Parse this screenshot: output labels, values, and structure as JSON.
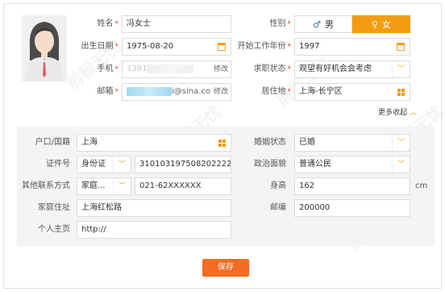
{
  "profile": {
    "name": {
      "label": "姓名",
      "value": "冯女士"
    },
    "gender": {
      "label": "性别",
      "male": "男",
      "female": "女",
      "selected": "女"
    },
    "birth": {
      "label": "出生日期",
      "value": "1975-08-20"
    },
    "work_start": {
      "label": "开始工作年份",
      "value": "1997"
    },
    "phone": {
      "label": "手机",
      "value_prefix": "1391",
      "edit": "修改"
    },
    "job_status": {
      "label": "求职状态",
      "value": "观望有好机会会考虑"
    },
    "email": {
      "label": "邮箱",
      "value_suffix": "i@sina.co",
      "edit": "修改"
    },
    "residence": {
      "label": "居住地",
      "value": "上海-长宁区"
    },
    "more_toggle": "更多收起"
  },
  "extra": {
    "hukou": {
      "label": "户口/国籍",
      "value": "上海"
    },
    "marital": {
      "label": "婚姻状态",
      "value": "已婚"
    },
    "id_doc": {
      "label": "证件号",
      "type": "身份证",
      "value": "310103197508202222"
    },
    "political": {
      "label": "政治面貌",
      "value": "普通公民"
    },
    "contact": {
      "label": "其他联系方式",
      "type": "家庭...",
      "value": "021-62XXXXXX"
    },
    "height": {
      "label": "身高",
      "value": "162",
      "unit": "cm"
    },
    "address": {
      "label": "家庭住址",
      "value": "上海红松路"
    },
    "postcode": {
      "label": "邮编",
      "value": "200000"
    },
    "homepage": {
      "label": "个人主页",
      "value": "http://"
    }
  },
  "actions": {
    "save": "保存"
  },
  "watermark": "前程无忧",
  "colors": {
    "accent": "#f39c12",
    "save": "#f36c21",
    "required": "#e4393c"
  }
}
